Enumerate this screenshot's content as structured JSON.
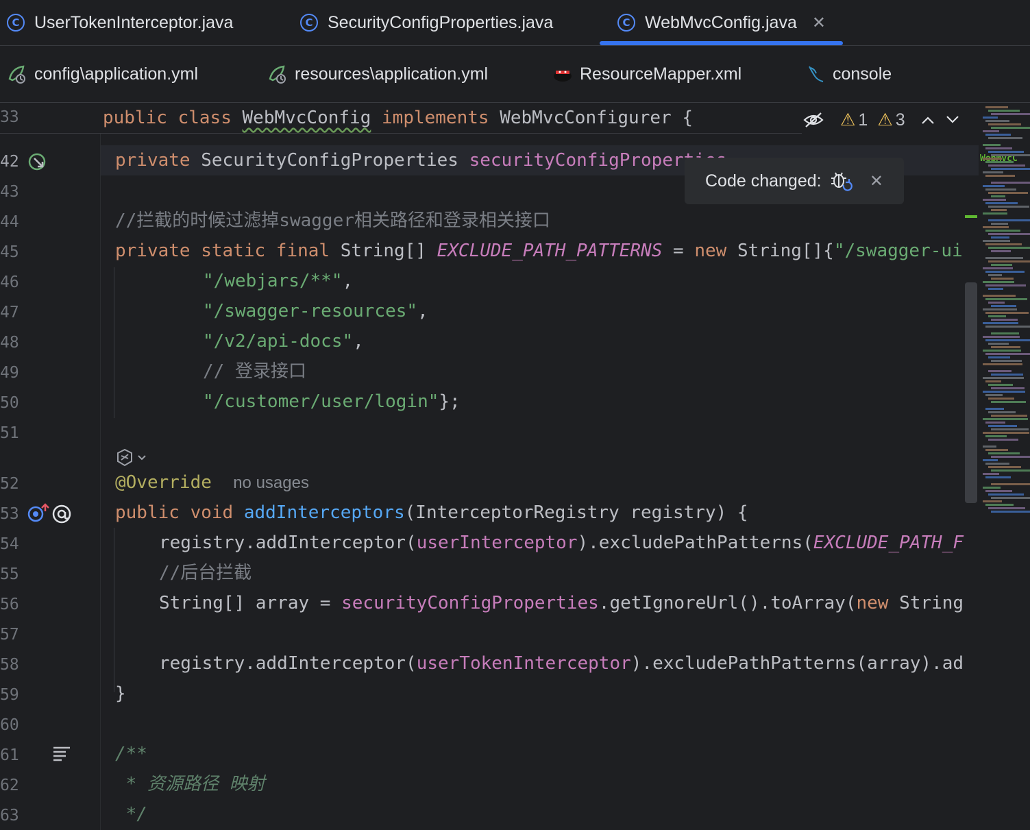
{
  "tabs_row1": [
    {
      "label": "UserTokenInterceptor.java",
      "icon": "class-icon"
    },
    {
      "label": "SecurityConfigProperties.java",
      "icon": "class-icon"
    },
    {
      "label": "WebMvcConfig.java",
      "icon": "class-icon",
      "active": true,
      "close": "✕"
    }
  ],
  "tabs_row2": [
    {
      "label": "config\\application.yml",
      "icon": "yaml-icon"
    },
    {
      "label": "resources\\application.yml",
      "icon": "yaml-icon"
    },
    {
      "label": "ResourceMapper.xml",
      "icon": "mybatis-icon"
    },
    {
      "label": "console",
      "icon": "database-console-icon"
    }
  ],
  "inspections": {
    "warnings_a": "1",
    "warnings_b": "3"
  },
  "popup": {
    "label": "Code changed:",
    "close": "✕"
  },
  "sticky": {
    "line": "33",
    "p1": "public",
    "p2": " ",
    "p3": "class",
    "p4": " ",
    "p5": "WebMvcConfig",
    "p6": " ",
    "p7": "implements",
    "p8": " WebMvcConfigurer {"
  },
  "lines": {
    "l42": "42",
    "l43": "43",
    "l44": "44",
    "l45": "45",
    "l46": "46",
    "l47": "47",
    "l48": "48",
    "l49": "49",
    "l50": "50",
    "l51": "51",
    "l52": "52",
    "l53": "53",
    "l54": "54",
    "l55": "55",
    "l56": "56",
    "l57": "57",
    "l58": "58",
    "l59": "59",
    "l60": "60",
    "l61": "61",
    "l62": "62",
    "l63": "63"
  },
  "code": {
    "c42a": "private",
    "c42b": " SecurityConfigProperties ",
    "c42c": "securityConfigProperties",
    "c44": "//拦截的时候过滤掉swagger相关路径和登录相关接口",
    "c45a": "private static final",
    "c45b": " String[] ",
    "c45c": "EXCLUDE_PATH_PATTERNS",
    "c45d": " = ",
    "c45e": "new",
    "c45f": " String[]{",
    "c45g": "\"/swagger-ui",
    "c46": "\"/webjars/**\"",
    "c46b": ",",
    "c47": "\"/swagger-resources\"",
    "c47b": ",",
    "c48": "\"/v2/api-docs\"",
    "c48b": ",",
    "c49": "// 登录接口",
    "c50": "\"/customer/user/login\"",
    "c50b": "};",
    "c52a": "@Override",
    "c52b": "no usages",
    "c53a": "public void",
    "c53b": " ",
    "c53c": "addInterceptors",
    "c53d": "(InterceptorRegistry registry) {",
    "c54a": "registry.addInterceptor(",
    "c54b": "userInterceptor",
    "c54c": ").excludePathPatterns(",
    "c54d": "EXCLUDE_PATH_F",
    "c55": "//后台拦截",
    "c56a": "String[] array = ",
    "c56b": "securityConfigProperties",
    "c56c": ".getIgnoreUrl().toArray(",
    "c56d": "new",
    "c56e": " String",
    "c58a": "registry.addInterceptor(",
    "c58b": "userTokenInterceptor",
    "c58c": ").excludePathPatterns(array).ad",
    "c59": "}",
    "c61": "/**",
    "c62": " * 资源路径 映射",
    "c63": " */"
  },
  "minimap": {
    "label": "WebMvcC"
  },
  "colors": {
    "accent": "#3574f0",
    "keyword": "#cf8e6d",
    "string": "#6aab73",
    "field": "#c77dbb",
    "function": "#56a8f5"
  }
}
